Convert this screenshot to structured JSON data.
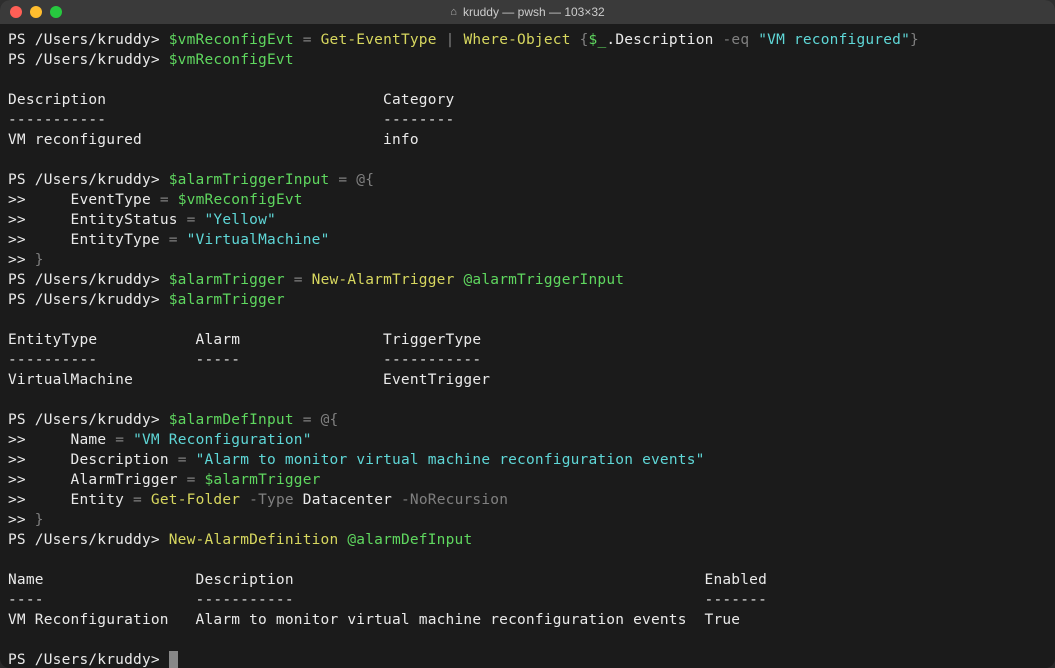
{
  "window": {
    "title": "kruddy — pwsh — 103×32"
  },
  "prompt": "PS /Users/kruddy> ",
  "continuation": ">>",
  "lines": {
    "l1": {
      "var": "$vmReconfigEvt",
      "eq": " = ",
      "cmd1": "Get-EventType",
      "pipe": " | ",
      "cmd2": "Where-Object",
      "brace_open": " {",
      "pipevar": "$_",
      "dot": ".Description ",
      "op": "-eq",
      "sp": " ",
      "str": "\"VM reconfigured\"",
      "brace_close": "}"
    },
    "l2": {
      "var": "$vmReconfigEvt"
    },
    "t1h": "Description                               Category",
    "t1d": "-----------                               --------",
    "t1r": "VM reconfigured                           info",
    "l3": {
      "var": "$alarmTriggerInput",
      "eq": " = ",
      "at": "@{"
    },
    "l3a": {
      "indent": "     ",
      "key": "EventType ",
      "eq": "= ",
      "val": "$vmReconfigEvt"
    },
    "l3b": {
      "indent": "     ",
      "key": "EntityStatus ",
      "eq": "= ",
      "val": "\"Yellow\""
    },
    "l3c": {
      "indent": "     ",
      "key": "EntityType ",
      "eq": "= ",
      "val": "\"VirtualMachine\""
    },
    "l3d": {
      "close": " }"
    },
    "l4": {
      "var": "$alarmTrigger",
      "eq": " = ",
      "cmd": "New-AlarmTrigger",
      "sp": " ",
      "splat": "@alarmTriggerInput"
    },
    "l5": {
      "var": "$alarmTrigger"
    },
    "t2h": "EntityType           Alarm                TriggerType",
    "t2d": "----------           -----                -----------",
    "t2r": "VirtualMachine                            EventTrigger",
    "l6": {
      "var": "$alarmDefInput",
      "eq": " = ",
      "at": "@{"
    },
    "l6a": {
      "indent": "     ",
      "key": "Name ",
      "eq": "= ",
      "val": "\"VM Reconfiguration\""
    },
    "l6b": {
      "indent": "     ",
      "key": "Description ",
      "eq": "= ",
      "val": "\"Alarm to monitor virtual machine reconfiguration events\""
    },
    "l6c": {
      "indent": "     ",
      "key": "AlarmTrigger ",
      "eq": "= ",
      "val": "$alarmTrigger"
    },
    "l6d": {
      "indent": "     ",
      "key": "Entity ",
      "eq": "= ",
      "cmd": "Get-Folder",
      "p1": " -Type",
      "a1": " Datacenter",
      "p2": " -NoRecursion"
    },
    "l6e": {
      "close": " }"
    },
    "l7": {
      "cmd": "New-AlarmDefinition",
      "sp": " ",
      "splat": "@alarmDefInput"
    },
    "t3h": "Name                 Description                                              Enabled",
    "t3d": "----                 -----------                                              -------",
    "t3r": "VM Reconfiguration   Alarm to monitor virtual machine reconfiguration events  True"
  }
}
